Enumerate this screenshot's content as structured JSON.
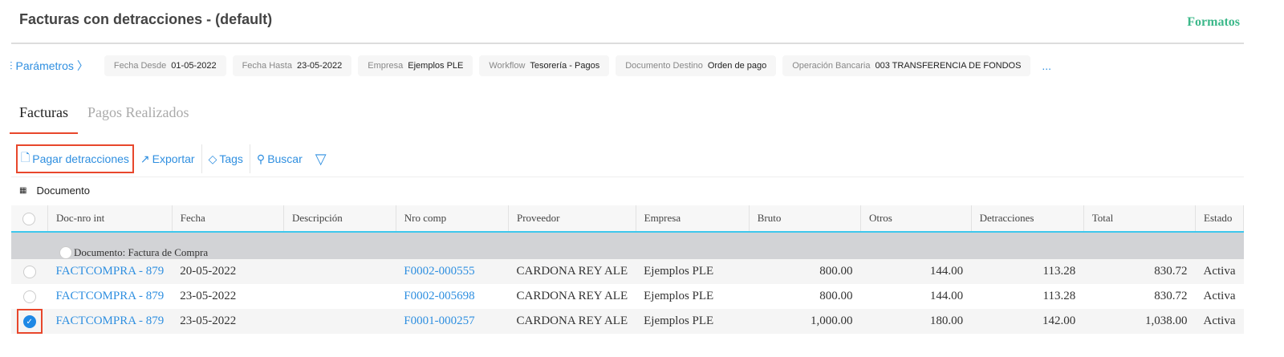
{
  "title": "Facturas con detracciones - (default)",
  "formatos": "Formatos",
  "params": {
    "label": "Parámetros",
    "more": "...",
    "chips": [
      {
        "k": "Fecha Desde",
        "v": "01-05-2022"
      },
      {
        "k": "Fecha Hasta",
        "v": "23-05-2022"
      },
      {
        "k": "Empresa",
        "v": "Ejemplos PLE"
      },
      {
        "k": "Workflow",
        "v": "Tesorería - Pagos"
      },
      {
        "k": "Documento Destino",
        "v": "Orden de pago"
      },
      {
        "k": "Operación Bancaria",
        "v": "003 TRANSFERENCIA DE FONDOS"
      }
    ]
  },
  "tabs": [
    "Facturas",
    "Pagos Realizados"
  ],
  "toolbar": {
    "pagar": "Pagar detracciones",
    "exportar": "Exportar",
    "tags": "Tags",
    "buscar": "Buscar"
  },
  "group_by": "Documento",
  "columns": [
    "Doc-nro int",
    "Fecha",
    "Descripción",
    "Nro comp",
    "Proveedor",
    "Empresa",
    "Bruto",
    "Otros",
    "Detracciones",
    "Total",
    "Estado"
  ],
  "group_label": "Documento: Factura de Compra",
  "rows": [
    [
      "FACTCOMPRA - 879",
      "20-05-2022",
      "",
      "F0002-000555",
      "CARDONA REY ALE",
      "Ejemplos PLE",
      "800.00",
      "144.00",
      "113.28",
      "830.72",
      "Activa"
    ],
    [
      "FACTCOMPRA - 879",
      "23-05-2022",
      "",
      "F0002-005698",
      "CARDONA REY ALE",
      "Ejemplos PLE",
      "800.00",
      "144.00",
      "113.28",
      "830.72",
      "Activa"
    ],
    [
      "FACTCOMPRA - 879",
      "23-05-2022",
      "",
      "F0001-000257",
      "CARDONA REY ALE",
      "Ejemplos PLE",
      "1,000.00",
      "180.00",
      "142.00",
      "1,038.00",
      "Activa"
    ]
  ],
  "selected": [
    false,
    false,
    true
  ]
}
